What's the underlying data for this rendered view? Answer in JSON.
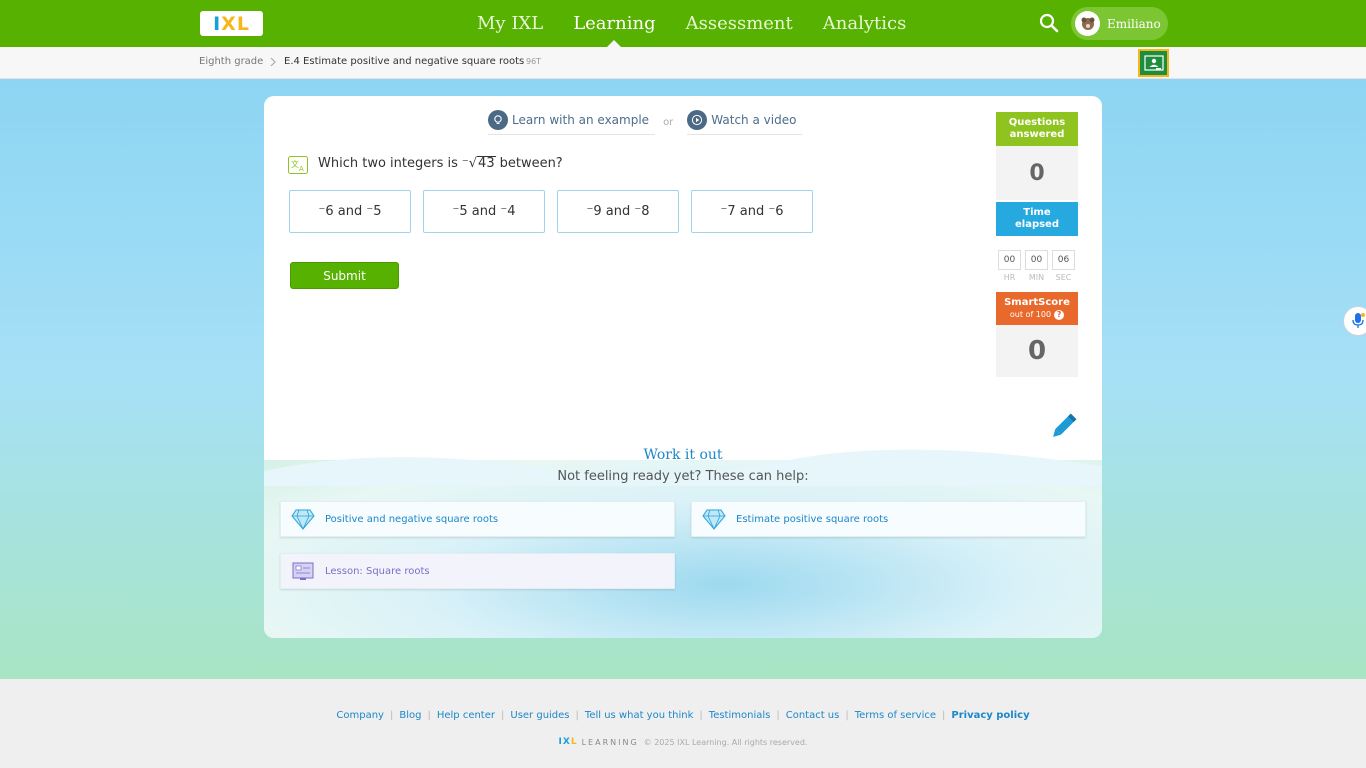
{
  "header": {
    "logo_parts": [
      "I",
      "X",
      "L"
    ],
    "nav": [
      {
        "label": "My IXL"
      },
      {
        "label": "Learning"
      },
      {
        "label": "Assessment"
      },
      {
        "label": "Analytics"
      }
    ],
    "user_name": "Emiliano"
  },
  "breadcrumb": {
    "grade": "Eighth grade",
    "skill": "E.4 Estimate positive and negative square roots",
    "code": "96T"
  },
  "help": {
    "example": "Learn with an example",
    "or": "or",
    "video": "Watch a video"
  },
  "question": {
    "before": "Which two integers is",
    "neg_sign": "⁻",
    "radicand": "43",
    "after": "between?"
  },
  "choices": [
    {
      "label": "⁻6 and ⁻5"
    },
    {
      "label": "⁻5 and ⁻4"
    },
    {
      "label": "⁻9 and ⁻8"
    },
    {
      "label": "⁻7 and ⁻6"
    }
  ],
  "submit_label": "Submit",
  "stats": {
    "questions_label_1": "Questions",
    "questions_label_2": "answered",
    "questions_value": "0",
    "time_label_1": "Time",
    "time_label_2": "elapsed",
    "timer": [
      {
        "value": "00",
        "unit": "HR"
      },
      {
        "value": "00",
        "unit": "MIN"
      },
      {
        "value": "06",
        "unit": "SEC"
      }
    ],
    "smartscore_label": "SmartScore",
    "smartscore_sub": "out of 100",
    "smartscore_help": "?",
    "smartscore_value": "0"
  },
  "work_it_out": {
    "title": "Work it out",
    "subtitle": "Not feeling ready yet? These can help:",
    "recommendations": [
      {
        "label": "Positive and negative square roots",
        "icon": "diamond-icon"
      },
      {
        "label": "Estimate positive square roots",
        "icon": "diamond-icon"
      },
      {
        "label": "Lesson: Square roots",
        "icon": "lesson-icon"
      }
    ]
  },
  "footer": {
    "links": [
      {
        "label": "Company"
      },
      {
        "label": "Blog"
      },
      {
        "label": "Help center"
      },
      {
        "label": "User guides"
      },
      {
        "label": "Tell us what you think"
      },
      {
        "label": "Testimonials"
      },
      {
        "label": "Contact us"
      },
      {
        "label": "Terms of service"
      },
      {
        "label": "Privacy policy"
      }
    ],
    "logo_a": "IX",
    "logo_b": "L",
    "learning": "LEARNING",
    "copyright": "© 2025 IXL Learning. All rights reserved."
  },
  "colors": {
    "brand_green": "#56b100",
    "accent_blue": "#26a9df",
    "smartscore_orange": "#e8692b",
    "questions_green": "#8fc31f"
  }
}
